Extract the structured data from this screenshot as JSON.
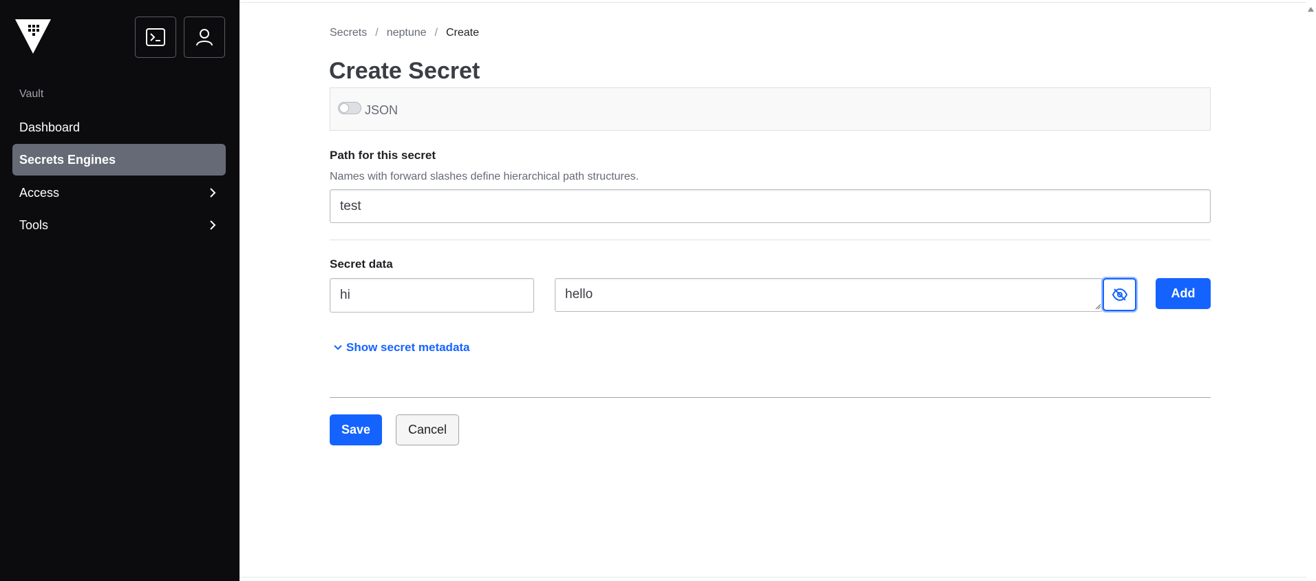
{
  "sidebar": {
    "nav_heading": "Vault",
    "items": [
      {
        "label": "Dashboard"
      },
      {
        "label": "Secrets Engines"
      },
      {
        "label": "Access"
      },
      {
        "label": "Tools"
      }
    ]
  },
  "breadcrumb": {
    "items": [
      "Secrets",
      "neptune",
      "Create"
    ],
    "separator": "/"
  },
  "page": {
    "title": "Create Secret"
  },
  "json_toggle": {
    "label": "JSON",
    "enabled": false
  },
  "path_field": {
    "label": "Path for this secret",
    "help": "Names with forward slashes define hierarchical path structures.",
    "value": "test"
  },
  "secret_data": {
    "label": "Secret data",
    "key_value": "hi",
    "value_value": "hello",
    "add_label": "Add"
  },
  "metadata": {
    "link_label": "Show secret metadata"
  },
  "actions": {
    "save_label": "Save",
    "cancel_label": "Cancel"
  },
  "colors": {
    "sidebar_bg": "#0c0c0e",
    "active_nav_bg": "#656a76",
    "primary": "#1563ff"
  },
  "icons": {
    "logo": "vault-logo-icon",
    "console": "terminal-icon",
    "user": "user-icon",
    "chevron": "chevron-right-icon",
    "mask": "eye-off-icon",
    "metadata": "chevron-down-icon"
  }
}
